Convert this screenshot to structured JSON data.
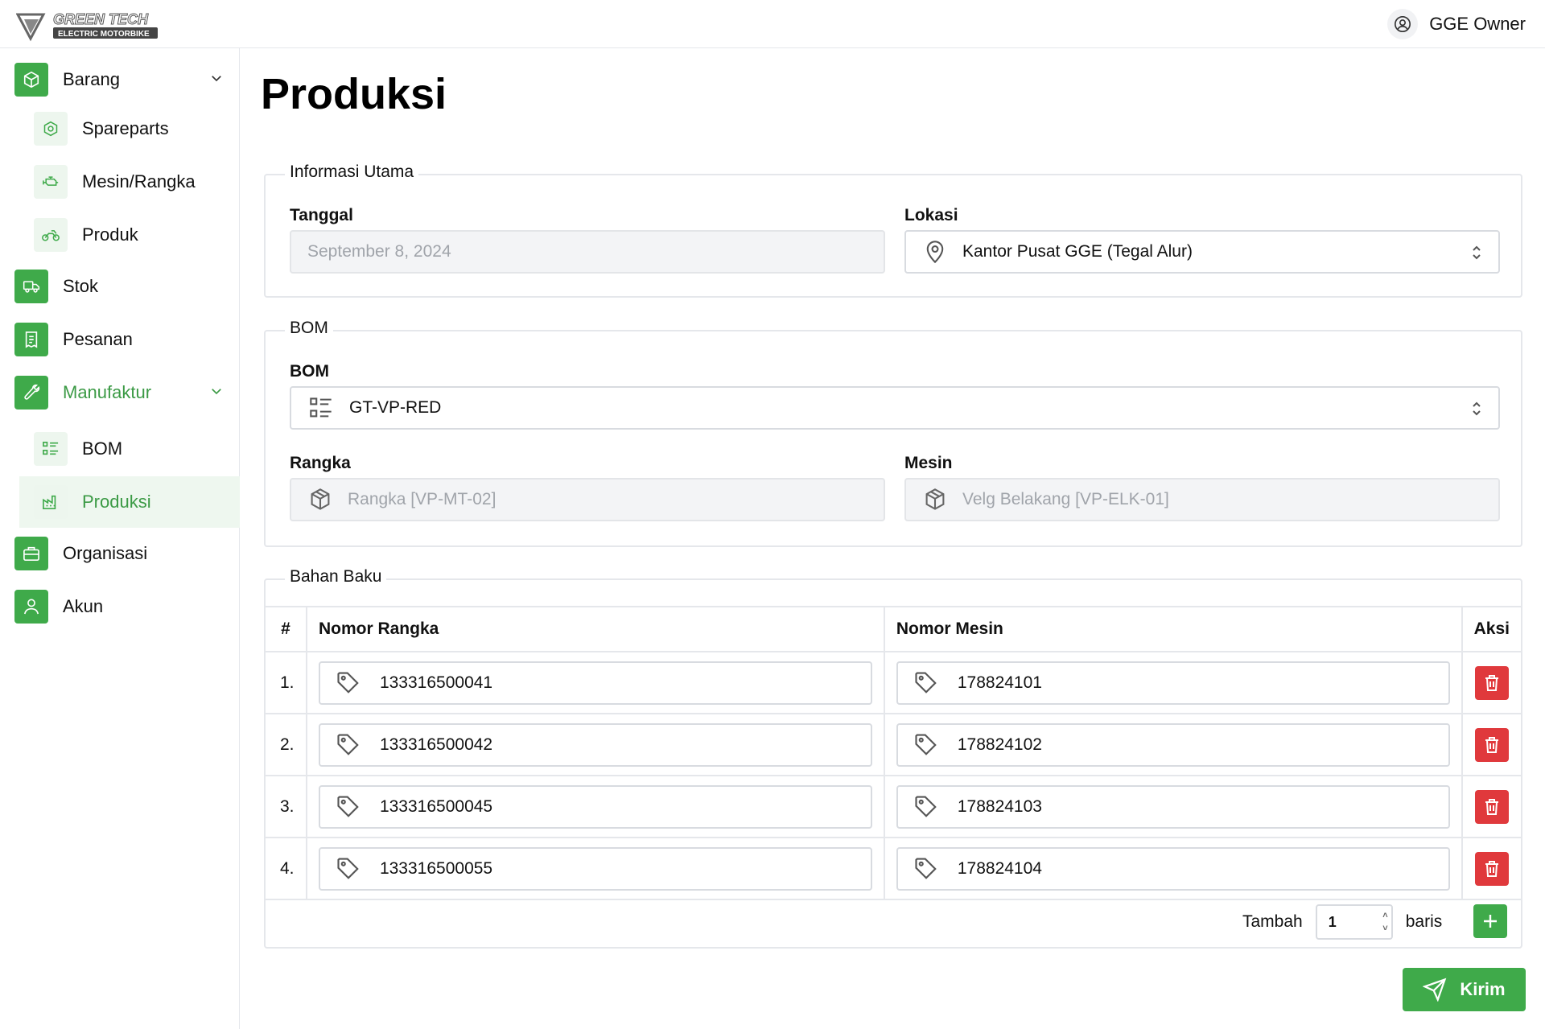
{
  "header": {
    "logo_text_top": "GREEN TECH",
    "logo_text_bottom": "ELECTRIC MOTORBIKE",
    "user_name": "GGE Owner"
  },
  "sidebar": {
    "items": [
      {
        "label": "Barang",
        "icon": "box-icon"
      },
      {
        "label": "Spareparts",
        "icon": "nut-icon"
      },
      {
        "label": "Mesin/Rangka",
        "icon": "engine-icon"
      },
      {
        "label": "Produk",
        "icon": "motorbike-icon"
      },
      {
        "label": "Stok",
        "icon": "truck-icon"
      },
      {
        "label": "Pesanan",
        "icon": "receipt-icon"
      },
      {
        "label": "Manufaktur",
        "icon": "tools-icon"
      },
      {
        "label": "BOM",
        "icon": "list-icon"
      },
      {
        "label": "Produksi",
        "icon": "factory-icon"
      },
      {
        "label": "Organisasi",
        "icon": "briefcase-icon"
      },
      {
        "label": "Akun",
        "icon": "user-icon"
      }
    ]
  },
  "page": {
    "title": "Produksi"
  },
  "info_utama": {
    "legend": "Informasi Utama",
    "tanggal_label": "Tanggal",
    "tanggal_value": "September 8, 2024",
    "lokasi_label": "Lokasi",
    "lokasi_value": "Kantor Pusat GGE (Tegal Alur)"
  },
  "bom": {
    "legend": "BOM",
    "bom_label": "BOM",
    "bom_value": "GT-VP-RED",
    "rangka_label": "Rangka",
    "rangka_value": "Rangka [VP-MT-02]",
    "mesin_label": "Mesin",
    "mesin_value": "Velg Belakang [VP-ELK-01]"
  },
  "bahan_baku": {
    "legend": "Bahan Baku",
    "columns": [
      "#",
      "Nomor Rangka",
      "Nomor Mesin",
      "Aksi"
    ],
    "rows": [
      {
        "no": "1.",
        "rangka": "133316500041",
        "mesin": "178824101"
      },
      {
        "no": "2.",
        "rangka": "133316500042",
        "mesin": "178824102"
      },
      {
        "no": "3.",
        "rangka": "133316500045",
        "mesin": "178824103"
      },
      {
        "no": "4.",
        "rangka": "133316500055",
        "mesin": "178824104"
      }
    ],
    "add_label": "Tambah",
    "add_value": "1",
    "add_suffix": "baris"
  },
  "submit_label": "Kirim",
  "colors": {
    "primary": "#3faa4a",
    "danger": "#e0393c",
    "active_bg": "#eef7ef"
  }
}
